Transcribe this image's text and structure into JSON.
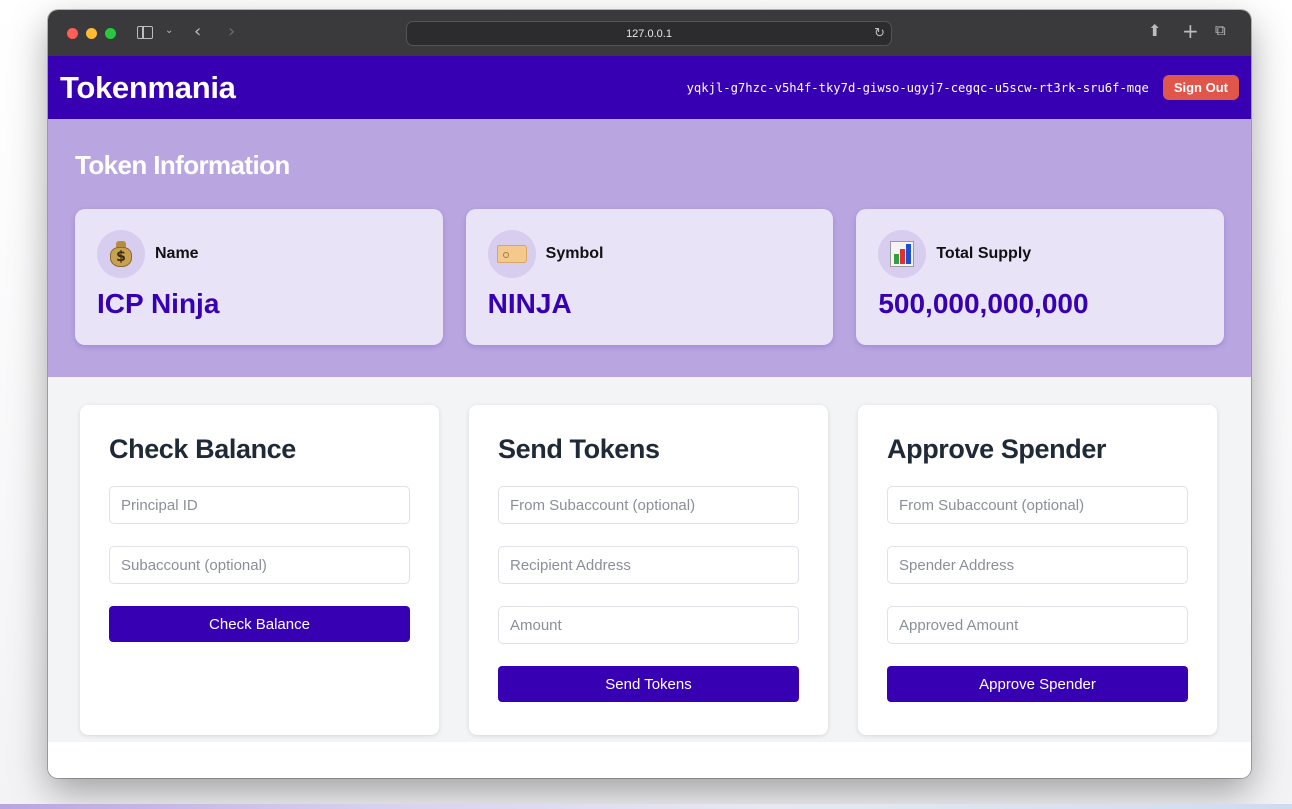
{
  "browser": {
    "url": "127.0.0.1",
    "icons": [
      "sidebar-icon",
      "chevron-down-icon",
      "back-icon",
      "forward-icon",
      "reload-icon",
      "share-icon",
      "new-tab-icon",
      "tabs-overview-icon"
    ]
  },
  "header": {
    "logo": "Tokenmania",
    "principal": "yqkjl-g7hzc-v5h4f-tky7d-giwso-ugyj7-cegqc-u5scw-rt3rk-sru6f-mqe",
    "sign_out": "Sign Out"
  },
  "token_info": {
    "title": "Token Information",
    "cards": [
      {
        "label": "Name",
        "value": "ICP Ninja",
        "icon": "money-bag-icon"
      },
      {
        "label": "Symbol",
        "value": "NINJA",
        "icon": "tag-icon"
      },
      {
        "label": "Total Supply",
        "value": "500,000,000,000",
        "icon": "bar-chart-icon"
      }
    ]
  },
  "check_balance": {
    "title": "Check Balance",
    "principal_placeholder": "Principal ID",
    "subaccount_placeholder": "Subaccount (optional)",
    "button": "Check Balance"
  },
  "send_tokens": {
    "title": "Send Tokens",
    "from_placeholder": "From Subaccount (optional)",
    "recipient_placeholder": "Recipient Address",
    "amount_placeholder": "Amount",
    "button": "Send Tokens"
  },
  "approve_spender": {
    "title": "Approve Spender",
    "from_placeholder": "From Subaccount (optional)",
    "spender_placeholder": "Spender Address",
    "amount_placeholder": "Approved Amount",
    "button": "Approve Spender"
  },
  "colors": {
    "brand": "#3700b3",
    "token_section_bg": "#b9a6e0",
    "card_bg": "#e8e3f7",
    "sign_out": "#e0564a"
  }
}
